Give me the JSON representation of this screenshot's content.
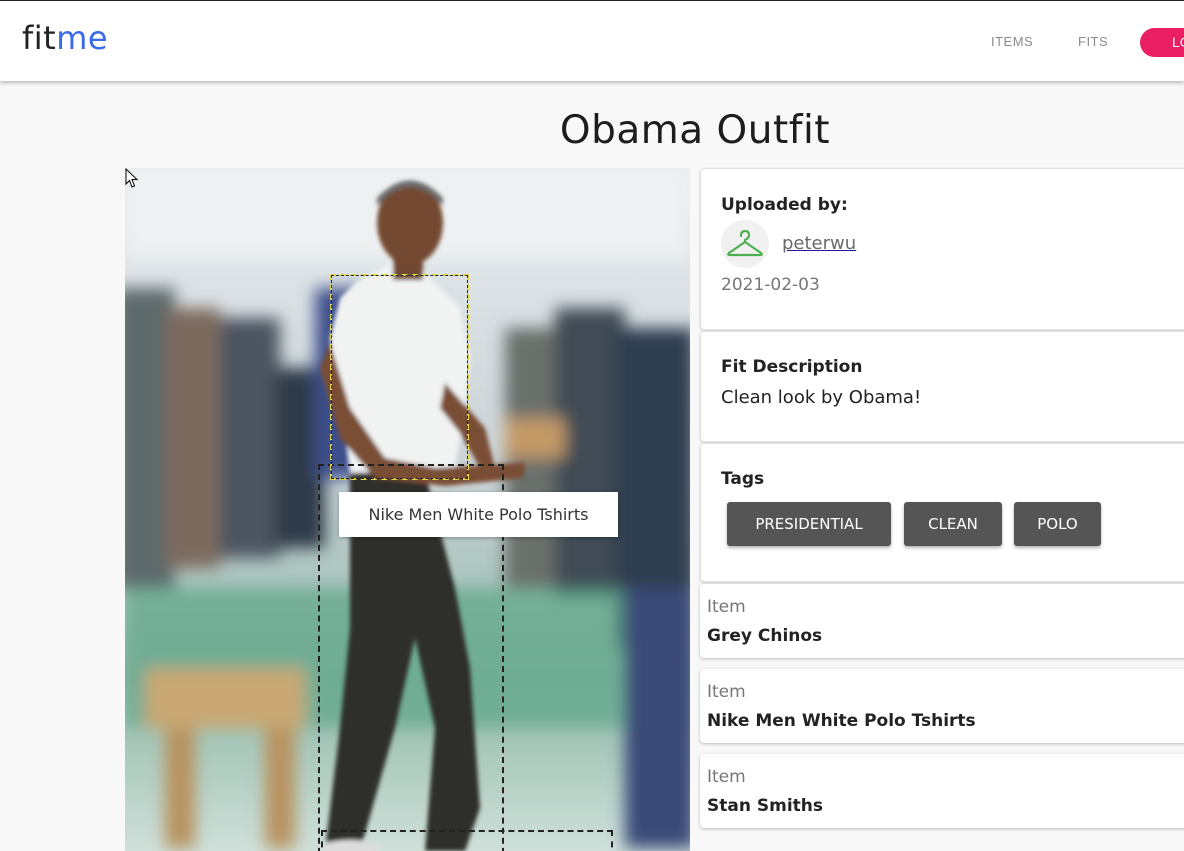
{
  "header": {
    "logo_fit": "fit",
    "logo_me": "me",
    "nav_items": "ITEMS",
    "nav_fits": "FITS",
    "login_label": "LO"
  },
  "page": {
    "title": "Obama Outfit"
  },
  "photo": {
    "tooltip": "Nike Men White Polo Tshirts"
  },
  "uploader": {
    "label": "Uploaded by:",
    "username": "peterwu",
    "date": "2021-02-03",
    "avatar_icon": "hanger-icon"
  },
  "description": {
    "label": "Fit Description",
    "text": "Clean look by Obama!"
  },
  "tags": {
    "label": "Tags",
    "items": [
      "PRESIDENTIAL",
      "CLEAN",
      "POLO"
    ]
  },
  "items": [
    {
      "kind": "Item",
      "name": "Grey Chinos"
    },
    {
      "kind": "Item",
      "name": "Nike Men White Polo Tshirts"
    },
    {
      "kind": "Item",
      "name": "Stan Smiths"
    }
  ],
  "colors": {
    "accent": "#e91e63",
    "logo_blue": "#3a6be6",
    "tag_bg": "#555555",
    "active_box": "#e3d64a"
  }
}
